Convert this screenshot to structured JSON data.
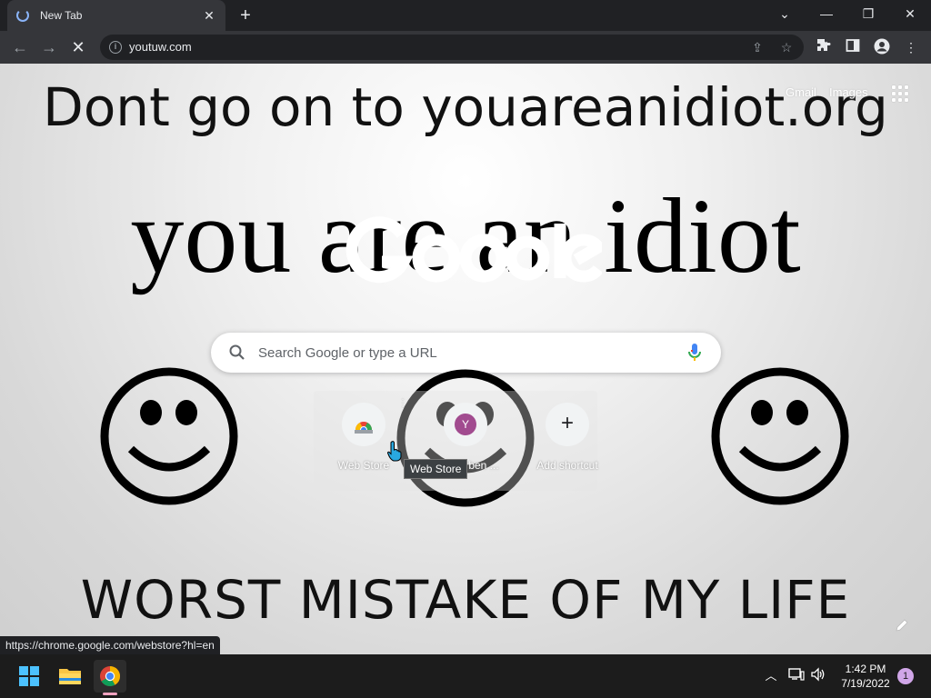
{
  "browser": {
    "tab_title": "New Tab",
    "url": "youtuw.com"
  },
  "page": {
    "headline": "Dont go on to youareanidiot.org",
    "idiot_text": "you are an idiot",
    "bottom_text": "WORST MISTAKE OF MY LIFE",
    "gmail_link": "Gmail",
    "images_link": "Images"
  },
  "search": {
    "placeholder": "Search Google or type a URL"
  },
  "shortcuts": [
    {
      "label": "Web Store",
      "initial": ""
    },
    {
      "label": "ben ...",
      "initial": "Y"
    },
    {
      "label": "Add shortcut",
      "initial": "+"
    }
  ],
  "tooltip": "Web Store",
  "status_url": "https://chrome.google.com/webstore?hl=en",
  "taskbar": {
    "time": "1:42 PM",
    "date": "7/19/2022",
    "notification_count": "1"
  },
  "colors": {
    "chrome_dark": "#202124",
    "toolbar": "#35363a",
    "shortcut_avatar": "#a14b8f"
  }
}
